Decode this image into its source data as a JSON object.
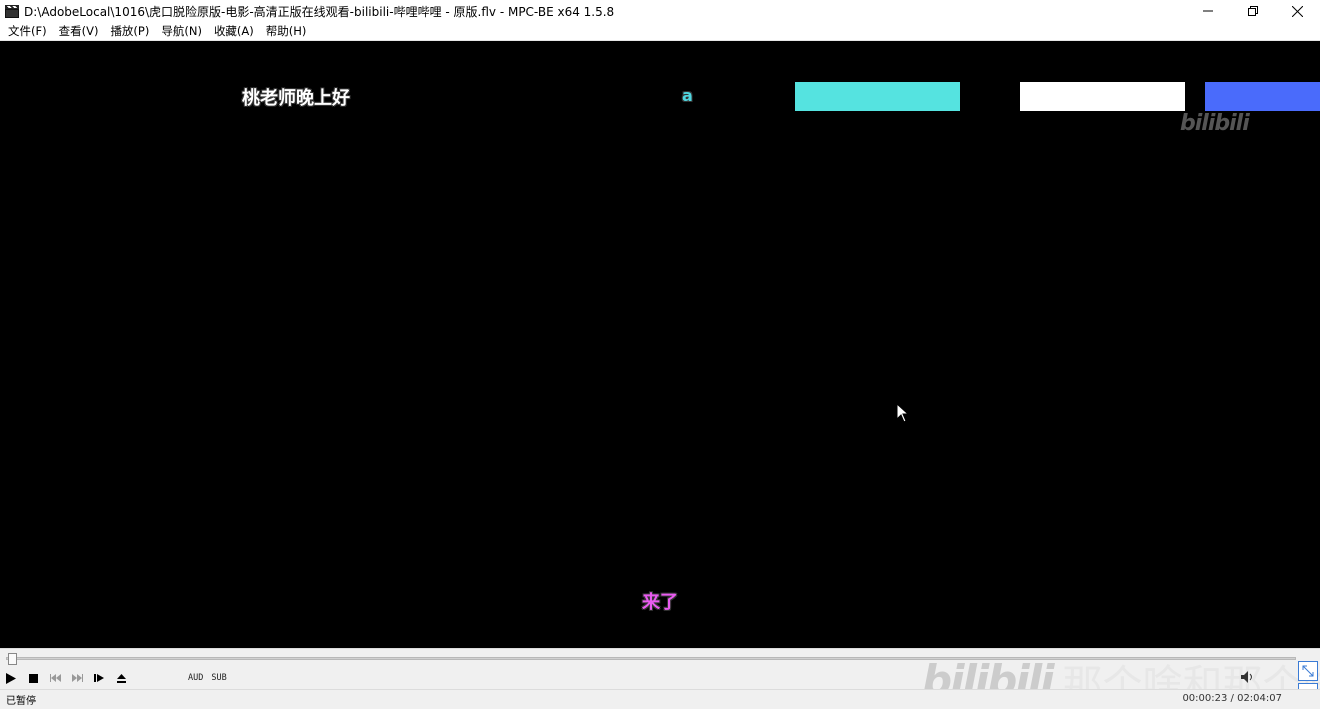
{
  "window": {
    "title": "D:\\AdobeLocal\\1016\\虎口脱险原版-电影-高清正版在线观看-bilibili-哔哩哔哩 - 原版.flv - MPC-BE x64 1.5.8",
    "app_icon": "clapperboard-icon",
    "controls": [
      "minimize-icon",
      "restore-icon",
      "close-icon"
    ]
  },
  "menu": [
    "文件(F)",
    "查看(V)",
    "播放(P)",
    "导航(N)",
    "收藏(A)",
    "帮助(H)"
  ],
  "video": {
    "danmaku": [
      {
        "text": "桃老师晚上好",
        "color": "#ffffff"
      },
      {
        "text": "a",
        "color": "#4fd7e0"
      },
      {
        "text": "来了",
        "color": "#e95bf0"
      }
    ],
    "color_blocks": [
      "#55e3e0",
      "#ffffff",
      "#4a6bfb"
    ],
    "watermark": "bilibili"
  },
  "seek": {
    "progress": 0.0031
  },
  "controls": {
    "buttons": [
      "play-icon",
      "stop-icon",
      "prev-icon",
      "next-icon",
      "frame-step-icon",
      "eject-icon"
    ],
    "aud_label": "AUD",
    "sub_label": "SUB"
  },
  "overlay_watermark": {
    "logo": "bilibili",
    "text": "那个啥和那个啥"
  },
  "status": {
    "state": "已暂停",
    "time": "00:00:23 / 02:04:07"
  }
}
